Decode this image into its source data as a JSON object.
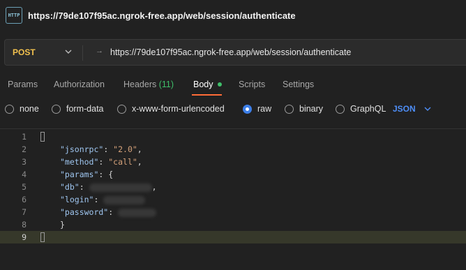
{
  "window": {
    "title": "https://79de107f95ac.ngrok-free.app/web/session/authenticate",
    "badge_text": "HTTP"
  },
  "request": {
    "method": "POST",
    "url": "https://79de107f95ac.ngrok-free.app/web/session/authenticate",
    "method_color": "#f2c14e"
  },
  "tabs": [
    {
      "label": "Params"
    },
    {
      "label": "Authorization"
    },
    {
      "label": "Headers",
      "count": "(11)"
    },
    {
      "label": "Body",
      "active": true
    },
    {
      "label": "Scripts"
    },
    {
      "label": "Settings"
    }
  ],
  "body_types": {
    "options": [
      "none",
      "form-data",
      "x-www-form-urlencoded",
      "raw",
      "binary",
      "GraphQL"
    ],
    "selected": "raw",
    "format": "JSON"
  },
  "editor": {
    "line_numbers": [
      "1",
      "2",
      "3",
      "4",
      "5",
      "6",
      "7",
      "8",
      "9"
    ],
    "lines": {
      "l2_key": "\"jsonrpc\"",
      "l2_val": "\"2.0\"",
      "l3_key": "\"method\"",
      "l3_val": "\"call\"",
      "l4_key": "\"params\"",
      "l4_brace": "{",
      "l5_key": "\"db\"",
      "l6_key": "\"login\"",
      "l7_key": "\"password\"",
      "l8_brace": "}"
    },
    "active_line": "9"
  },
  "colors": {
    "accent": "#ff6c37",
    "green": "#3fbf6a",
    "link_blue": "#4e8ef7"
  },
  "icons": {
    "method_dropdown": "chevron-down-icon",
    "url_arrow": "arrow-right-icon",
    "format_dropdown": "chevron-down-icon"
  }
}
